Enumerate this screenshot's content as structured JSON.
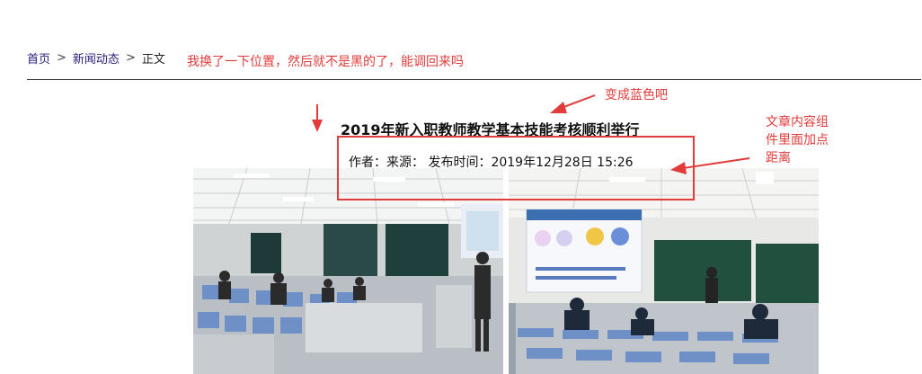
{
  "breadcrumb": {
    "home": "首页",
    "sep1": ">",
    "news": "新闻动态",
    "sep2": ">",
    "current": "正文"
  },
  "article": {
    "title": "2019年新入职教师教学基本技能考核顺利举行",
    "meta": "作者：来源： 发布时间：2019年12月28日 15:26"
  },
  "annotations": {
    "breadcrumb_note": "我换了一下位置，然后就不是黑的了，能调回来吗",
    "title_note": "变成蓝色吧",
    "spacing_note": "文章内容组件里面加点距离"
  },
  "colors": {
    "annotation": "#e23b3b",
    "breadcrumb": "#2a2080"
  }
}
